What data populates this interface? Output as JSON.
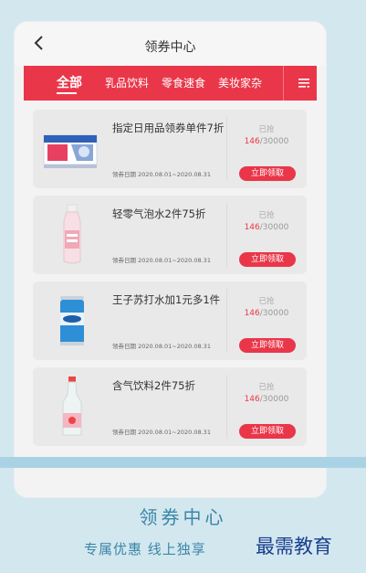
{
  "header": {
    "title": "领券中心"
  },
  "tabs": [
    {
      "label": "全部",
      "active": true
    },
    {
      "label": "乳品饮料",
      "active": false
    },
    {
      "label": "零食速食",
      "active": false
    },
    {
      "label": "美妆家杂",
      "active": false
    }
  ],
  "coupons": [
    {
      "name": "指定日用品领券单件7折",
      "date_label": "领券日期",
      "date_range": "2020.08.01~2020.08.31",
      "grabbed_label": "已抢",
      "grabbed": "146",
      "total": "/30000",
      "button": "立即领取"
    },
    {
      "name": "轻零气泡水2件75折",
      "date_label": "领券日期",
      "date_range": "2020.08.01~2020.08.31",
      "grabbed_label": "已抢",
      "grabbed": "146",
      "total": "/30000",
      "button": "立即领取"
    },
    {
      "name": "王子苏打水加1元多1件",
      "date_label": "领券日期",
      "date_range": "2020.08.01~2020.08.31",
      "grabbed_label": "已抢",
      "grabbed": "146",
      "total": "/30000",
      "button": "立即领取"
    },
    {
      "name": "含气饮料2件75折",
      "date_label": "领券日期",
      "date_range": "2020.08.01~2020.08.31",
      "grabbed_label": "已抢",
      "grabbed": "146",
      "total": "/30000",
      "button": "立即领取"
    }
  ],
  "promo": {
    "line1": "领券中心",
    "line2": "专属优惠 线上独享"
  },
  "watermark": "最需教育",
  "colors": {
    "accent": "#ea3649",
    "promo_text": "#3a86a8",
    "background": "#d3e7ef"
  }
}
